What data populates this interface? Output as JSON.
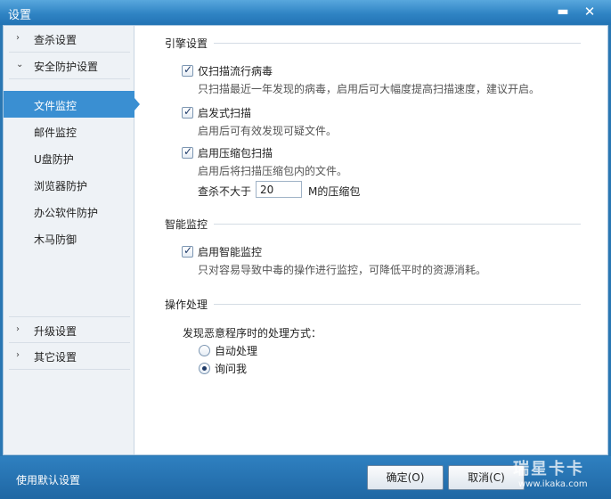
{
  "window": {
    "title": "设置",
    "minimize_glyph": "▬",
    "close_glyph": "✕"
  },
  "sidebar": {
    "groups_top": [
      {
        "label": "查杀设置",
        "icon": "chevron-right-icon",
        "glyph": "›"
      },
      {
        "label": "安全防护设置",
        "icon": "chevron-down-icon",
        "glyph": "⌄"
      }
    ],
    "items": [
      {
        "label": "文件监控",
        "active": true
      },
      {
        "label": "邮件监控"
      },
      {
        "label": "U盘防护"
      },
      {
        "label": "浏览器防护"
      },
      {
        "label": "办公软件防护"
      },
      {
        "label": "木马防御"
      }
    ],
    "groups_bottom": [
      {
        "label": "升级设置",
        "icon": "chevron-right-icon",
        "glyph": "›"
      },
      {
        "label": "其它设置",
        "icon": "chevron-right-icon",
        "glyph": "›"
      }
    ]
  },
  "engine": {
    "title": "引擎设置",
    "options": [
      {
        "label": "仅扫描流行病毒",
        "desc": "只扫描最近一年发现的病毒，启用后可大幅度提高扫描速度，建议开启。",
        "checked": true
      },
      {
        "label": "启发式扫描",
        "desc": "启用后可有效发现可疑文件。",
        "checked": true
      },
      {
        "label": "启用压缩包扫描",
        "desc": "启用后将扫描压缩包内的文件。",
        "checked": true
      }
    ],
    "archive_limit": {
      "prefix": "查杀不大于",
      "value": "20",
      "suffix": "M的压缩包"
    }
  },
  "smart": {
    "title": "智能监控",
    "option": {
      "label": "启用智能监控",
      "desc": "只对容易导致中毒的操作进行监控，可降低平时的资源消耗。",
      "checked": true
    }
  },
  "action": {
    "title": "操作处理",
    "prompt": "发现恶意程序时的处理方式：",
    "choices": [
      {
        "label": "自动处理",
        "selected": false
      },
      {
        "label": "询问我",
        "selected": true
      }
    ]
  },
  "footer": {
    "default_link": "使用默认设置",
    "ok_label": "确定(O)",
    "cancel_label": "取消(C)"
  },
  "watermark": {
    "brand": "瑞星卡卡",
    "url": "www.ikaka.com"
  },
  "check_glyph": "✓"
}
